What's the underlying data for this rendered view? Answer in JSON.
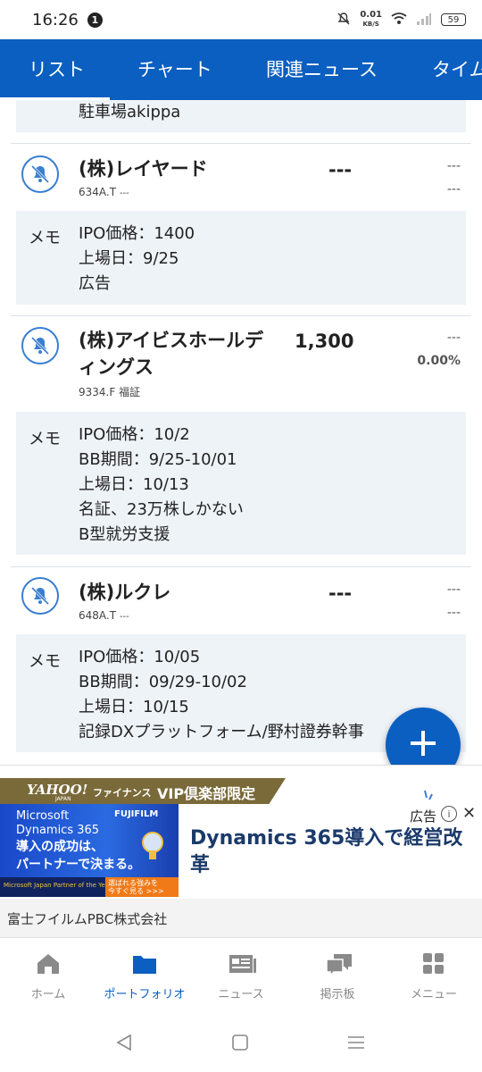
{
  "status_bar": {
    "time": "16:26",
    "notification_count": "1",
    "net_speed_value": "0.01",
    "net_speed_unit": "KB/S",
    "battery": "59"
  },
  "tabs": [
    {
      "label": "リスト",
      "active": true
    },
    {
      "label": "チャート"
    },
    {
      "label": "関連ニュース"
    },
    {
      "label": "タイム"
    }
  ],
  "partial_item": {
    "memo_last_line": "駐車場akippa"
  },
  "stocks": [
    {
      "name": "(株)レイヤード",
      "code": "634A.T",
      "market": "---",
      "price": "---",
      "change": "---",
      "change_pct": "---",
      "memo_label": "メモ",
      "memo": [
        "IPO価格：1400",
        "上場日：9/25",
        "広告"
      ]
    },
    {
      "name_line1": "(株)アイビスホールデ",
      "name_line2": "ィングス",
      "code": "9334.F",
      "market": "福証",
      "price": "1,300",
      "change": "---",
      "change_pct": "0.00%",
      "memo_label": "メモ",
      "memo": [
        "IPO価格：10/2",
        "BB期間：9/25-10/01",
        "上場日：10/13",
        "名証、23万株しかない",
        "B型就労支援"
      ]
    },
    {
      "name": "(株)ルクレ",
      "code": "648A.T",
      "market": "---",
      "price": "---",
      "change": "---",
      "change_pct": "---",
      "memo_label": "メモ",
      "memo": [
        "IPO価格：10/05",
        "BB期間：09/29-10/02",
        "上場日：10/15",
        "記録DXプラットフォーム/野村證券幹事"
      ]
    }
  ],
  "fab": {
    "icon": "plus-icon"
  },
  "promo": {
    "yahoo": "YAHOO!",
    "japan": "JAPAN",
    "finance": "ファイナンス",
    "vip": "VIP倶楽部限定"
  },
  "ad": {
    "label": "広告",
    "image_brand": "Microsoft Dynamics 365",
    "image_brand_line1": "Microsoft",
    "image_brand_line2": "Dynamics 365",
    "image_partner": "FUJIFILM",
    "image_copy_line1": "導入の成功は、",
    "image_copy_line2": "パートナーで決まる。",
    "image_award": "Microsoft Japan Partner of the Year 4年連続受賞!",
    "image_cta_line1": "選ばれる強みを",
    "image_cta_line2": "今すぐ見る >>>",
    "headline": "Dynamics 365導入で経営改革",
    "advertiser": "富士フイルムPBC株式会社"
  },
  "bottom_nav": [
    {
      "label": "ホーム",
      "icon": "home-icon"
    },
    {
      "label": "ポートフォリオ",
      "icon": "folder-icon",
      "active": true
    },
    {
      "label": "ニュース",
      "icon": "news-icon"
    },
    {
      "label": "掲示板",
      "icon": "chat-icon"
    },
    {
      "label": "メニュー",
      "icon": "grid-icon"
    }
  ],
  "colors": {
    "primary": "#0a5fc0",
    "memo_bg": "#eef3f8",
    "promo_gold": "#7a6a3a"
  }
}
